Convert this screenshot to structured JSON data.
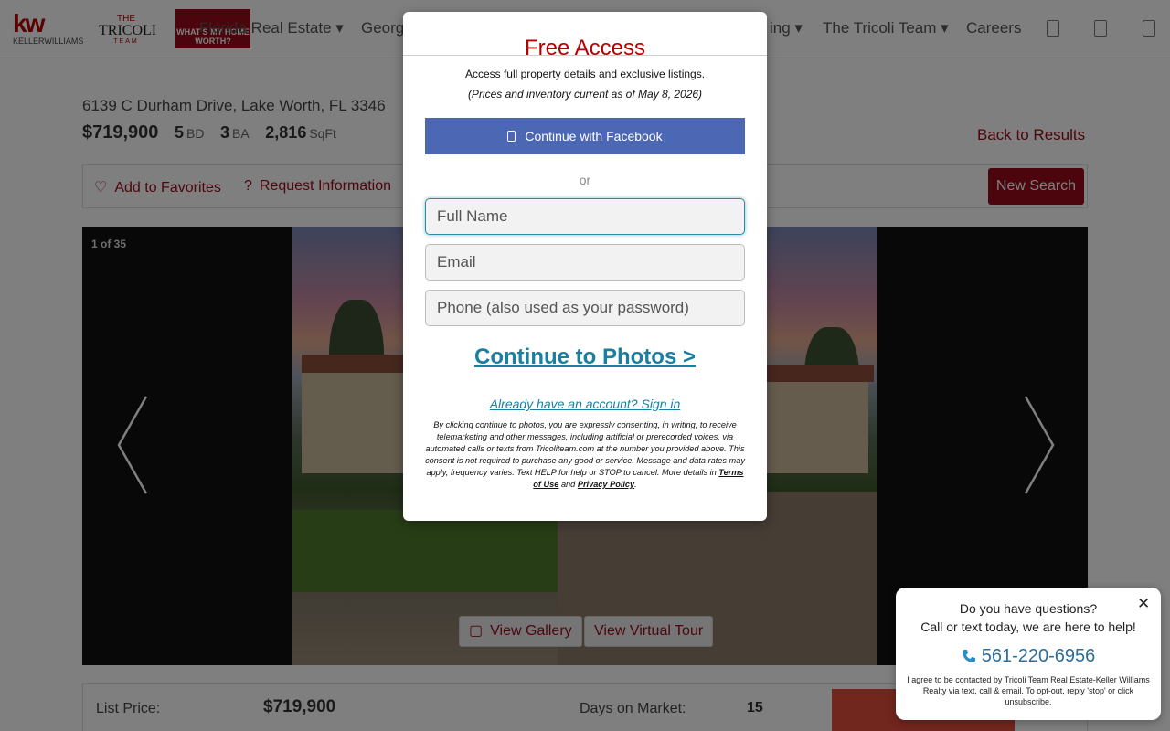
{
  "header": {
    "brand": "kw",
    "brand_sub": "KELLERWILLIAMS",
    "logo2_top": "THE",
    "logo2_name": "TRICOLI",
    "logo2_team": "TEAM",
    "logo3_text": "WHAT'S MY HOME WORTH?",
    "nav": [
      {
        "label": "Florida Real Estate ▾"
      },
      {
        "label": "Georgia"
      },
      {
        "label": "ing ▾"
      },
      {
        "label": "The Tricoli Team ▾"
      },
      {
        "label": "Careers"
      }
    ]
  },
  "listing": {
    "address": "6139 C Durham Drive, Lake Worth, FL 3346",
    "price": "$719,900",
    "beds": "5",
    "beds_unit": "BD",
    "baths": "3",
    "baths_unit": "BA",
    "sqft": "2,816",
    "sqft_unit": "SqFt",
    "back_label": "Back to Results",
    "favorites_label": "Add to Favorites",
    "request_label": "Request Information",
    "new_search_label": "New Search",
    "photo_counter": "1 of 35",
    "gallery_label": "View Gallery",
    "tour_label": "View Virtual Tour",
    "list_price_label": "List Price:",
    "list_price_value": "$719,900",
    "dom_label": "Days on Market:",
    "dom_value": "15"
  },
  "modal": {
    "title": "Free Access",
    "subtitle": "Access full property details and exclusive listings.",
    "subtitle2": "(Prices and inventory current as of May 8, 2026)",
    "facebook_label": "Continue with Facebook",
    "or_label": "or",
    "name_placeholder": "Full Name",
    "email_placeholder": "Email",
    "phone_placeholder": "Phone (also used as your password)",
    "continue_label": "Continue to Photos >",
    "signin_label": "Already have an account? Sign in",
    "consent_text": "By clicking continue to photos, you are expressly consenting, in writing, to receive telemarketing and other messages, including artificial or prerecorded voices, via automated calls or texts from Tricoliteam.com at the number you provided above. This consent is not required to purchase any good or service. Message and data rates may apply, frequency varies. Text HELP for help or STOP to cancel. More details in ",
    "terms_label": "Terms of Use",
    "and_label": " and ",
    "privacy_label": "Privacy Policy",
    "period": "."
  },
  "chat": {
    "line1": "Do you have questions?",
    "line2": "Call or text today, we are here to help!",
    "phone": "561-220-6956",
    "close": "✕",
    "fine_print": "I agree to be contacted by Tricoli Team Real Estate-Keller Williams Realty via text, call & email. To opt-out, reply 'stop' or click unsubscribe."
  },
  "icons": {
    "favorites": "heart-icon",
    "request": "question-icon",
    "gallery": "camera-icon",
    "phone": "phone-icon",
    "facebook": "facebook-icon"
  },
  "colors": {
    "brand_red": "#9a0b1a",
    "title_red": "#b40101",
    "link_blue": "#1a7fa0",
    "facebook_blue": "#4c67b4"
  }
}
